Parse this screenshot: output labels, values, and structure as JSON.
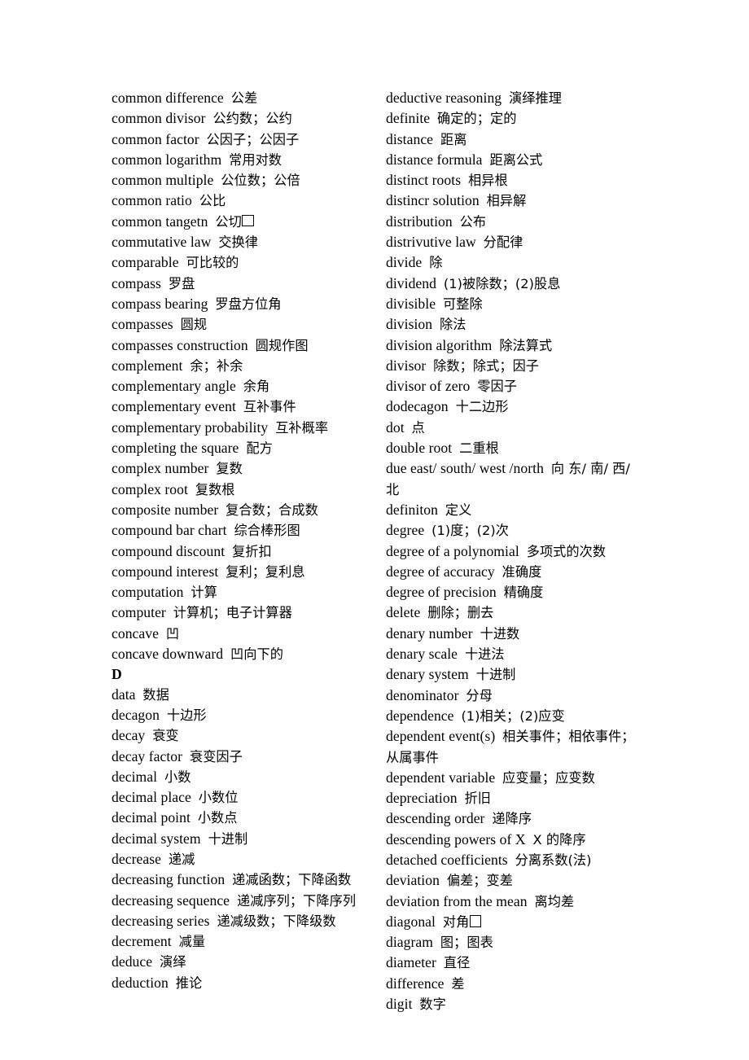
{
  "document": {
    "type": "bilingual-glossary",
    "subject": "mathematics",
    "section_heading": "D",
    "page_background": "#ffffff",
    "text_color": "#000000"
  },
  "left_column": {
    "entries": [
      {
        "term": "common difference",
        "gloss": "公差"
      },
      {
        "term": "common divisor",
        "gloss": "公约数；公约"
      },
      {
        "term": "common factor",
        "gloss": "公因子；公因子"
      },
      {
        "term": "common logarithm",
        "gloss": "常用对数"
      },
      {
        "term": "common multiple",
        "gloss": "公位数；公倍"
      },
      {
        "term": "common ratio",
        "gloss": "公比"
      },
      {
        "term": "common tangetn",
        "gloss": "公切",
        "tofu": true
      },
      {
        "term": "commutative law",
        "gloss": "交换律"
      },
      {
        "term": "comparable",
        "gloss": "可比较的"
      },
      {
        "term": "compass",
        "gloss": "罗盘"
      },
      {
        "term": "compass bearing",
        "gloss": "罗盘方位角"
      },
      {
        "term": "compasses",
        "gloss": "圆规"
      },
      {
        "term": "compasses construction",
        "gloss": "圆规作图"
      },
      {
        "term": "complement",
        "gloss": "余；补余"
      },
      {
        "term": "complementary angle",
        "gloss": "余角"
      },
      {
        "term": "complementary event",
        "gloss": "互补事件"
      },
      {
        "term": "complementary probability",
        "gloss": "互补概率"
      },
      {
        "term": "completing the square",
        "gloss": "配方"
      },
      {
        "term": "complex number",
        "gloss": "复数"
      },
      {
        "term": "complex root",
        "gloss": "复数根"
      },
      {
        "term": "composite number",
        "gloss": "复合数；合成数"
      },
      {
        "term": "compound bar chart",
        "gloss": "综合棒形图"
      },
      {
        "term": "compound discount",
        "gloss": "复折扣"
      },
      {
        "term": "compound interest",
        "gloss": "复利；复利息"
      },
      {
        "term": "computation",
        "gloss": "计算"
      },
      {
        "term": "computer",
        "gloss": "计算机；电子计算器"
      },
      {
        "term": "concave",
        "gloss": "凹"
      },
      {
        "term": "concave downward",
        "gloss": "凹向下的"
      },
      {
        "heading": "D"
      },
      {
        "term": "data",
        "gloss": "数据"
      },
      {
        "term": "decagon",
        "gloss": "十边形"
      },
      {
        "term": "decay",
        "gloss": "衰变"
      },
      {
        "term": "decay factor",
        "gloss": "衰变因子"
      },
      {
        "term": "decimal",
        "gloss": "小数"
      },
      {
        "term": "decimal place",
        "gloss": "小数位"
      },
      {
        "term": "decimal point",
        "gloss": "小数点"
      },
      {
        "term": "decimal system",
        "gloss": "十进制"
      },
      {
        "term": "decrease",
        "gloss": "递减"
      },
      {
        "term": "decreasing function",
        "gloss": "递减函数；下降函数"
      },
      {
        "term": "decreasing sequence",
        "gloss": "递减序列；下降序列"
      },
      {
        "term": "decreasing series",
        "gloss": "递减级数；下降级数"
      },
      {
        "term": "decrement",
        "gloss": "减量"
      },
      {
        "term": "deduce",
        "gloss": "演绎"
      },
      {
        "term": "deduction",
        "gloss": "推论"
      }
    ]
  },
  "right_column": {
    "entries": [
      {
        "term": "deductive reasoning",
        "gloss": "演绎推理"
      },
      {
        "term": "definite",
        "gloss": "确定的；定的"
      },
      {
        "term": "distance",
        "gloss": "距离"
      },
      {
        "term": "distance formula",
        "gloss": "距离公式"
      },
      {
        "term": "distinct roots",
        "gloss": "相异根"
      },
      {
        "term": "distincr solution",
        "gloss": "相异解"
      },
      {
        "term": "distribution",
        "gloss": "公布"
      },
      {
        "term": "distrivutive law",
        "gloss": "分配律"
      },
      {
        "term": "divide",
        "gloss": "除"
      },
      {
        "term": "dividend",
        "gloss": "(1)被除数；(2)股息"
      },
      {
        "term": "divisible",
        "gloss": "可整除"
      },
      {
        "term": "division",
        "gloss": "除法"
      },
      {
        "term": "division algorithm",
        "gloss": "除法算式"
      },
      {
        "term": "divisor",
        "gloss": "除数；除式；因子"
      },
      {
        "term": "divisor of zero",
        "gloss": "零因子"
      },
      {
        "term": "dodecagon",
        "gloss": "十二边形"
      },
      {
        "term": "dot",
        "gloss": "点"
      },
      {
        "term": "double root",
        "gloss": "二重根"
      },
      {
        "term": "due east/ south/ west /north",
        "gloss": "向 东/ 南/ 西/ 北"
      },
      {
        "term": "definiton",
        "gloss": "定义"
      },
      {
        "term": "degree",
        "gloss": "(1)度；(2)次"
      },
      {
        "term": "degree of a polynomial",
        "gloss": "多项式的次数"
      },
      {
        "term": "degree of accuracy",
        "gloss": "准确度"
      },
      {
        "term": "degree of precision",
        "gloss": "精确度"
      },
      {
        "term": "delete",
        "gloss": "删除；删去"
      },
      {
        "term": "denary number",
        "gloss": "十进数"
      },
      {
        "term": "denary scale",
        "gloss": "十进法"
      },
      {
        "term": "denary system",
        "gloss": "十进制"
      },
      {
        "term": "denominator",
        "gloss": "分母"
      },
      {
        "term": "dependence",
        "gloss": "(1)相关；(2)应变"
      },
      {
        "term": "dependent event(s)",
        "gloss": "相关事件；相依事件；从属事件"
      },
      {
        "term": "dependent variable",
        "gloss": "应变量；应变数"
      },
      {
        "term": "depreciation",
        "gloss": "折旧"
      },
      {
        "term": "descending order",
        "gloss": "递降序"
      },
      {
        "term": "descending powers of X",
        "gloss": "X 的降序"
      },
      {
        "term": "detached coefficients",
        "gloss": "分离系数(法)"
      },
      {
        "term": "deviation",
        "gloss": "偏差；变差"
      },
      {
        "term": "deviation from the mean",
        "gloss": "离均差"
      },
      {
        "term": "diagonal",
        "gloss": "对角",
        "tofu": true
      },
      {
        "term": "diagram",
        "gloss": "图；图表"
      },
      {
        "term": "diameter",
        "gloss": "直径"
      },
      {
        "term": "difference",
        "gloss": "差"
      },
      {
        "term": "digit",
        "gloss": "数字"
      }
    ]
  }
}
